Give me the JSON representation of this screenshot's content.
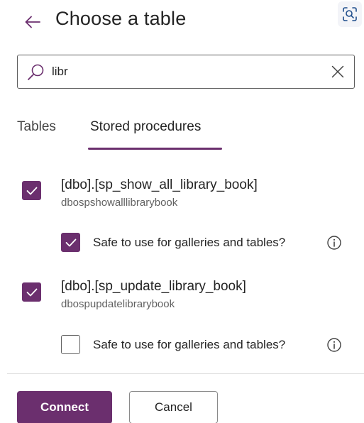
{
  "header": {
    "title": "Choose a table",
    "back_icon": "arrow-left-icon",
    "scan_icon": "visual-search-icon"
  },
  "search": {
    "value": "libr",
    "icon": "search-icon",
    "clear_icon": "close-icon"
  },
  "tabs": [
    {
      "label": "Tables",
      "selected": false
    },
    {
      "label": "Stored procedures",
      "selected": true
    }
  ],
  "procedures": [
    {
      "name": "[dbo].[sp_show_all_library_book]",
      "subtitle": "dbospshowalllibrarybook",
      "checked": true,
      "safe_label": "Safe to use for galleries and tables?",
      "safe_checked": true
    },
    {
      "name": "[dbo].[sp_update_library_book]",
      "subtitle": "dbospupdatelibrarybook",
      "checked": true,
      "safe_label": "Safe to use for galleries and tables?",
      "safe_checked": false
    }
  ],
  "footer": {
    "connect_label": "Connect",
    "cancel_label": "Cancel"
  },
  "colors": {
    "accent": "#6b2f6e",
    "text": "#242424",
    "subtext": "#616161"
  }
}
